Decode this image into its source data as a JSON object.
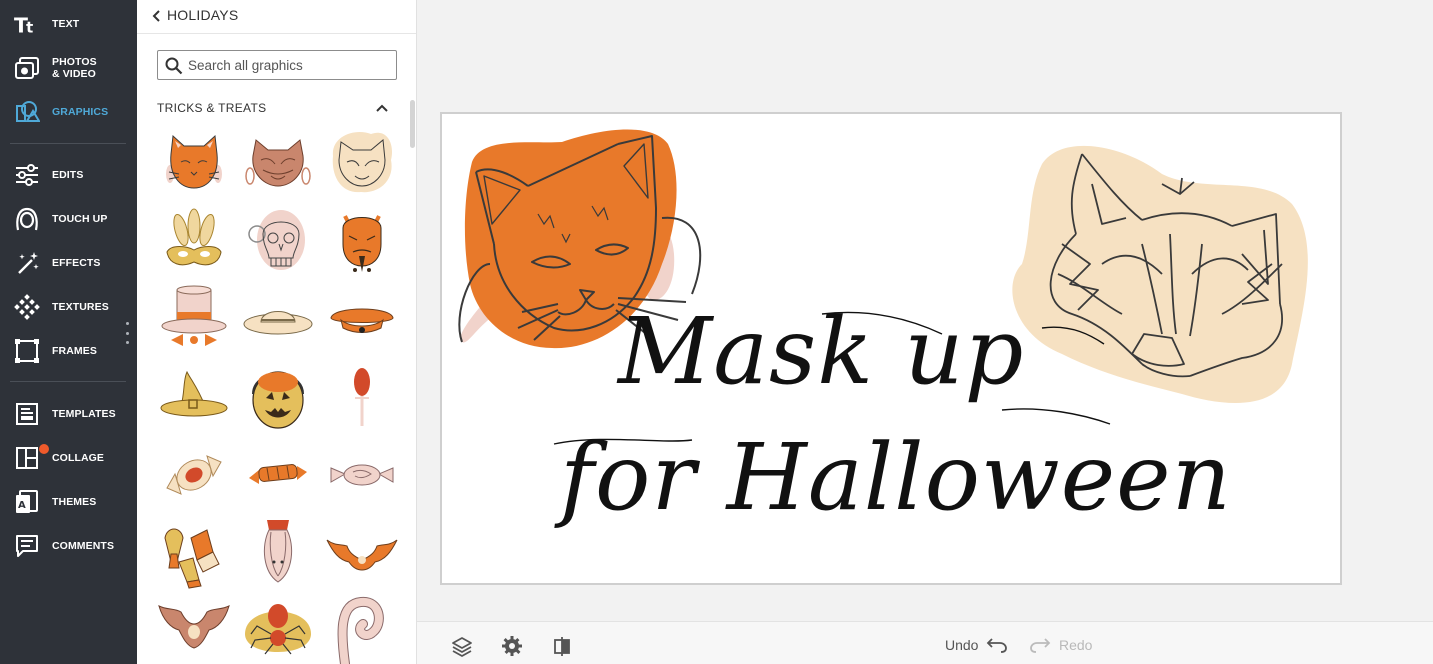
{
  "toolbar": {
    "items": [
      {
        "label": "TEXT",
        "icon": "text-icon"
      },
      {
        "label": "PHOTOS\n& VIDEO",
        "icon": "photos-icon"
      },
      {
        "label": "GRAPHICS",
        "icon": "graphics-icon",
        "active": true
      },
      {
        "label": "EDITS",
        "icon": "sliders-icon"
      },
      {
        "label": "TOUCH UP",
        "icon": "touchup-face-icon"
      },
      {
        "label": "EFFECTS",
        "icon": "magic-wand-icon"
      },
      {
        "label": "TEXTURES",
        "icon": "texture-icon"
      },
      {
        "label": "FRAMES",
        "icon": "frame-icon"
      },
      {
        "label": "TEMPLATES",
        "icon": "template-icon"
      },
      {
        "label": "COLLAGE",
        "icon": "collage-icon"
      },
      {
        "label": "THEMES",
        "icon": "themes-icon"
      },
      {
        "label": "COMMENTS",
        "icon": "comment-icon"
      }
    ]
  },
  "panel": {
    "title": "HOLIDAYS",
    "search_placeholder": "Search all graphics",
    "section_title": "TRICKS & TREATS",
    "thumbnails": [
      "cat-mask-orange",
      "fox-mask-brown",
      "fox-mask-beige",
      "feather-mask",
      "skull-mask",
      "devil-mask",
      "top-hat",
      "straw-hat",
      "beret-cap",
      "witch-hat",
      "pumpkin-bucket",
      "lollipop",
      "wrapped-candy",
      "stick-candy",
      "twist-candy",
      "candy-corn",
      "hanging-bat",
      "flying-bat",
      "bat",
      "spider",
      "worm"
    ]
  },
  "canvas": {
    "line1": "Mask up",
    "line2": "for Halloween"
  },
  "bottombar": {
    "undo_label": "Undo",
    "redo_label": "Redo"
  },
  "colors": {
    "toolbar_bg": "#2e3239",
    "accent": "#4fa9d8",
    "orange": "#e8792a",
    "beige": "#f6e1c2",
    "pink": "#f1d3cb"
  }
}
